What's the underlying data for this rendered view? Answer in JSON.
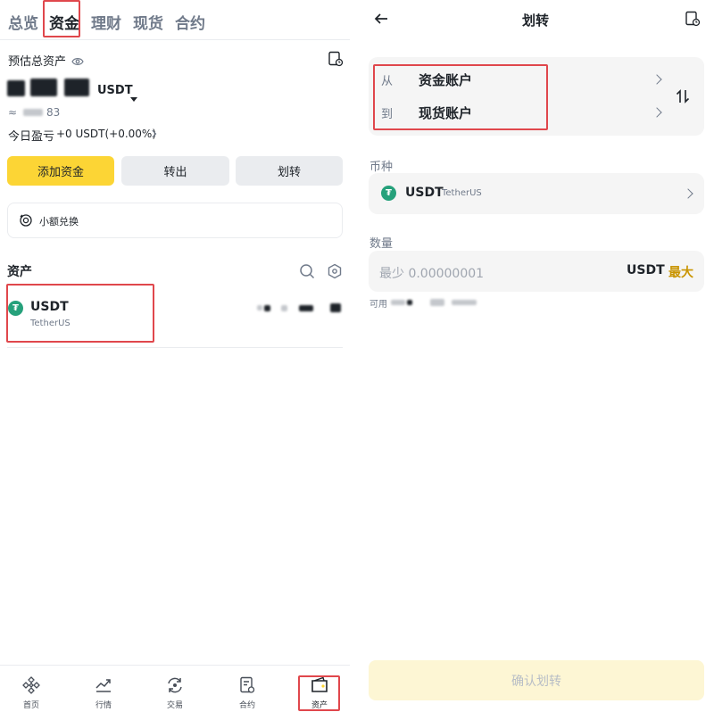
{
  "left": {
    "tabs": [
      "总览",
      "资金",
      "理财",
      "现货",
      "合约"
    ],
    "active_tab": "资金",
    "estimated_label": "预估总资产",
    "balance_currency": "USDT",
    "approx_prefix": "≈",
    "approx_suffix": "83",
    "today_pnl_label": "今日盈亏",
    "today_pnl_value": "+0 USDT(+0.00%)",
    "buttons": {
      "add": "添加资金",
      "withdraw": "转出",
      "transfer": "划转"
    },
    "small_convert": "小额兑换",
    "assets_title": "资产",
    "asset": {
      "symbol": "USDT",
      "name": "TetherUS"
    },
    "nav": [
      "首页",
      "行情",
      "交易",
      "合约",
      "资产"
    ]
  },
  "right": {
    "title": "划转",
    "from_label": "从",
    "from_value": "资金账户",
    "to_label": "到",
    "to_value": "现货账户",
    "currency_label": "币种",
    "currency_symbol": "USDT",
    "currency_name": "TetherUS",
    "amount_label": "数量",
    "amount_placeholder": "最少 0.00000001",
    "amount_unit": "USDT",
    "max_label": "最大",
    "available_label": "可用",
    "confirm": "确认划转"
  },
  "colors": {
    "accent_yellow": "#fcd535",
    "max_yellow": "#c99400",
    "highlight_red": "#e0474c",
    "tether_green": "#26a17b"
  },
  "icons": [
    "eye-icon",
    "history-icon",
    "caret-down-icon",
    "chevron-right-icon",
    "convert-icon",
    "search-icon",
    "settings-icon",
    "back-arrow-icon",
    "swap-icon",
    "home-icon",
    "markets-icon",
    "trade-icon",
    "futures-icon",
    "wallet-icon"
  ]
}
